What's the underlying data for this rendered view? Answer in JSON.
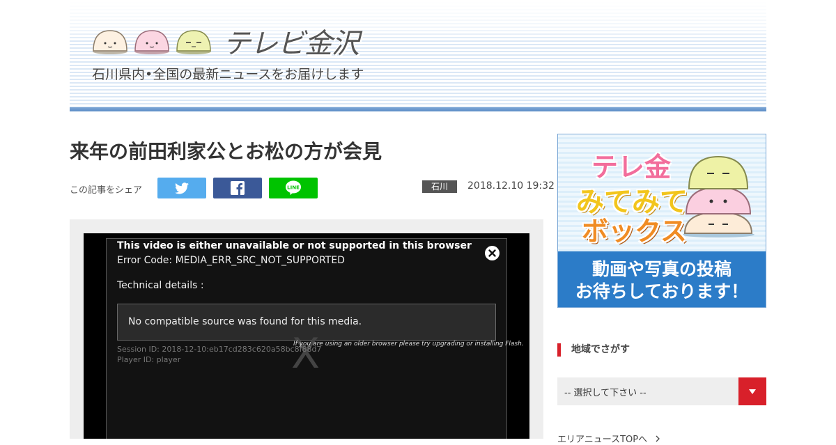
{
  "header": {
    "logo_text": "テレビ金沢",
    "tagline": "石川県内•全国の最新ニュースをお届けします"
  },
  "article": {
    "title": "来年の前田利家公とお松の方が会見",
    "share_label": "この記事をシェア",
    "region": "石川",
    "timestamp": "2018.12.10 19:32"
  },
  "player_error": {
    "title": "This video is either unavailable or not supported in this browser",
    "code": "Error Code: MEDIA_ERR_SRC_NOT_SUPPORTED",
    "technical": "Technical details :",
    "source_message": "No compatible source was found for this media.",
    "session": "Session ID: 2018-12-10:eb17cd283c620a58bc8f88d7",
    "player": "Player ID: player",
    "hint": "If you are using an older browser please try upgrading or installing Flash.",
    "x_mark": "X"
  },
  "sidebar": {
    "promo": {
      "line1": "テレ金",
      "line2": "みてみて",
      "line3": "ボックス",
      "cta1": "動画や写真の投稿",
      "cta2": "お待ちしております！"
    },
    "section_title": "地域でさがす",
    "select_value": "-- 選択して下さい --",
    "area_link": "エリアニュースTOPへ"
  },
  "icons": [
    "twitter-icon",
    "facebook-icon",
    "line-icon",
    "close-icon",
    "dropdown-arrow-icon",
    "chevron-right-icon"
  ],
  "colors": {
    "twitter": "#55acee",
    "facebook": "#3b5998",
    "line": "#00c300",
    "accent_red": "#d8202a",
    "banner_blue": "#5b8cc6"
  }
}
